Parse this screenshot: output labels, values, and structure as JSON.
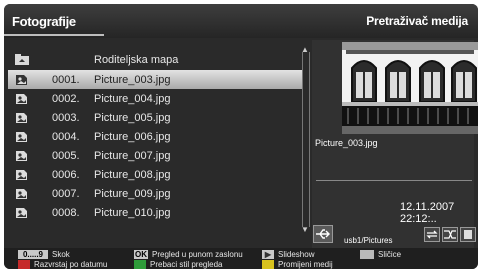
{
  "header": {
    "title": "Fotografije",
    "right_title": "Pretraživač medija"
  },
  "list": {
    "parent_label": "Roditeljska mapa",
    "selected_index": 0,
    "items": [
      {
        "num": "0001.",
        "name": "Picture_003.jpg"
      },
      {
        "num": "0002.",
        "name": "Picture_004.jpg"
      },
      {
        "num": "0003.",
        "name": "Picture_005.jpg"
      },
      {
        "num": "0004.",
        "name": "Picture_006.jpg"
      },
      {
        "num": "0005.",
        "name": "Picture_007.jpg"
      },
      {
        "num": "0006.",
        "name": "Picture_008.jpg"
      },
      {
        "num": "0007.",
        "name": "Picture_009.jpg"
      },
      {
        "num": "0008.",
        "name": "Picture_010.jpg"
      }
    ]
  },
  "preview": {
    "filename": "Picture_003.jpg",
    "date": "12.11.2007 22:12:..",
    "source": "usb1/Pictures"
  },
  "legend": {
    "digits_key": "0.....9",
    "skip": "Skok",
    "ok_key": "OK",
    "fullscreen": "Pregled u punom zaslonu",
    "slideshow": "Slideshow",
    "thumbnails": "Sličice",
    "sort_by_date": "Razvrstaj po datumu",
    "switch_view": "Prebaci stil pregleda",
    "change_media": "Promijeni medij"
  },
  "colors": {
    "background": "#2a2a2a",
    "selected_row": "#c4c4c4",
    "red_key": "#c62a2a",
    "green_key": "#2e9b3a",
    "yellow_key": "#d8c21e",
    "blue_key": "#2d4fb8"
  }
}
